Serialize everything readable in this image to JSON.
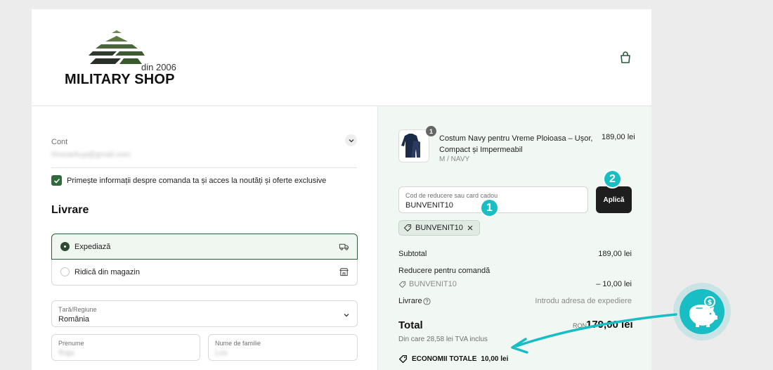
{
  "header": {
    "logo_text": "MILITARY SHOP",
    "logo_since": "din 2006",
    "cart_icon": "shopping-bag-icon"
  },
  "account": {
    "label": "Cont",
    "email": "hhsoarkup@gmail.com",
    "newsletter_checked": true,
    "newsletter_label": "Primește informații despre comanda ta și acces la noutăți și oferte exclusive"
  },
  "delivery": {
    "title": "Livrare",
    "options": [
      {
        "label": "Expediază",
        "selected": true,
        "icon": "truck-icon"
      },
      {
        "label": "Ridică din magazin",
        "selected": false,
        "icon": "store-icon"
      }
    ]
  },
  "form": {
    "country_label": "Țară/Regiune",
    "country_value": "România",
    "first_name_label": "Prenume",
    "first_name_value": "Raja",
    "last_name_label": "Nume de familie",
    "last_name_value": "Los"
  },
  "summary": {
    "product": {
      "qty": "1",
      "name": "Costum Navy pentru Vreme Ploioasa – Ușor, Compact și Impermeabil",
      "variant": "M / NAVY",
      "price": "189,00 lei"
    },
    "coupon": {
      "placeholder": "Cod de reducere sau card cadou",
      "value": "BUNVENIT10",
      "apply_label": "Aplică",
      "applied_code": "BUNVENIT10"
    },
    "markers": [
      "1",
      "2"
    ],
    "subtotal_label": "Subtotal",
    "subtotal_value": "189,00 lei",
    "discount_label": "Reducere pentru comandă",
    "discount_code": "BUNVENIT10",
    "discount_value": "– 10,00 lei",
    "shipping_label": "Livrare",
    "shipping_value": "Introdu adresa de expediere",
    "total_label": "Total",
    "total_currency": "RON",
    "total_value": "179,00 lei",
    "vat_text": "Din care 28,58 lei TVA inclus",
    "savings_label": "ECONOMII TOTALE",
    "savings_value": "10,00 lei"
  },
  "colors": {
    "accent_green": "#2e6a3a",
    "summary_bg": "#f1f8f3",
    "highlight_teal": "#19bdc4"
  }
}
